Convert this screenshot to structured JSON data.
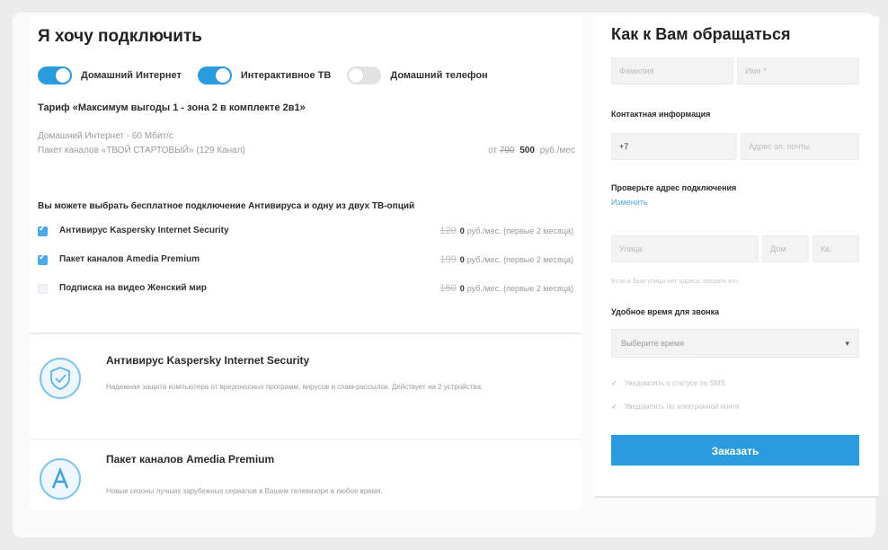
{
  "left": {
    "title": "Я хочу подключить",
    "toggles": [
      {
        "label": "Домашний Интернет",
        "on": true
      },
      {
        "label": "Интерактивное ТВ",
        "on": true
      },
      {
        "label": "Домашний телефон",
        "on": false
      }
    ],
    "tariff": "Тариф «Максимум выгоды 1 - зона 2 в комплекте 2в1»",
    "line1": "Домашний Интернет - 60 Мбит/с",
    "line2": "Пакет каналов «ТВОЙ СТАРТОВЫЙ» (129 Канал)",
    "price_prefix": "от",
    "price_old": "790",
    "price_value": "500",
    "price_unit": "руб./мес",
    "options_heading": "Вы можете выбрать бесплатное подключение Антивируса и одну из двух ТВ-опций",
    "options": [
      {
        "label": "Антивирус Kaspersky Internet Security",
        "checked": true,
        "old": "120",
        "new": "0",
        "unit": "руб./мес. (первые 2 месяца)"
      },
      {
        "label": "Пакет каналов Amedia Premium",
        "checked": true,
        "old": "199",
        "new": "0",
        "unit": "руб./мес. (первые 2 месяца)"
      },
      {
        "label": "Подписка на видео Женский мир",
        "checked": false,
        "old": "160",
        "new": "0",
        "unit": "руб./мес. (первые 2 месяца)"
      }
    ],
    "features": [
      {
        "icon": "shield-check-icon",
        "title": "Антивирус Kaspersky Internet Security",
        "desc": "Надежная защита компьютера от вредоносных программ, вирусов и спам-рассылок. Действует на 2 устройства."
      },
      {
        "icon": "amedia-logo-icon",
        "title": "Пакет каналов Amedia Premium",
        "desc": "Новые сезоны лучших зарубежных сериалов в Вашем телевизоре в любое время."
      }
    ]
  },
  "right": {
    "title": "Как к Вам обращаться",
    "surname_placeholder": "Фамилия",
    "name_placeholder": "Имя *",
    "contact_label": "Контактная информация",
    "phone_value": "+7",
    "email_placeholder": "Адрес эл. почты",
    "address_label": "Проверьте адрес подключения",
    "address_link": "Изменить",
    "street_placeholder": "Улица",
    "house_placeholder": "Дом",
    "flat_placeholder": "Кв.",
    "address_hint": "Если в базе улицы нет адреса, введите его",
    "time_label": "Удобное время для звонка",
    "time_select": "Выберите время",
    "checks": [
      {
        "label": "Уведомлять о статусе по SMS"
      },
      {
        "label": "Уведомлять по электронной почте"
      }
    ],
    "order_button": "Заказать"
  },
  "colors": {
    "accent": "#2b9be0",
    "toggle_off": "#e2e2e2"
  }
}
